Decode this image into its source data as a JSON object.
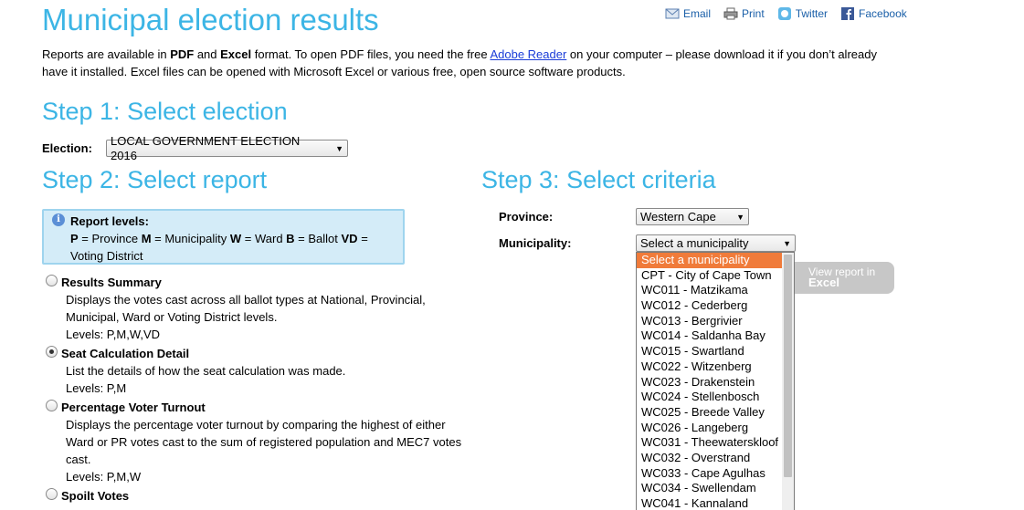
{
  "page": {
    "title": "Municipal election results",
    "intro": {
      "part1": "Reports are available in ",
      "pdf": "PDF",
      "part2": " and ",
      "excel": "Excel",
      "part3": " format. To open PDF files, you need the free ",
      "link": "Adobe Reader",
      "part4": " on your computer – please download it if you don’t already have it installed. Excel files can be opened with Microsoft Excel or various free, open source software products."
    }
  },
  "share": {
    "email": "Email",
    "print": "Print",
    "twitter": "Twitter",
    "facebook": "Facebook"
  },
  "step1": {
    "heading": "Step 1: Select election",
    "label": "Election:",
    "selected": "LOCAL GOVERNMENT ELECTION 2016"
  },
  "step2": {
    "heading": "Step 2: Select report",
    "info": {
      "title": "Report levels:",
      "p": "P",
      "p_txt": " = Province ",
      "m": "M",
      "m_txt": " = Municipality ",
      "w": "W",
      "w_txt": " = Ward ",
      "b": "B",
      "b_txt": " = Ballot ",
      "vd": "VD",
      "vd_txt": " = Voting District"
    },
    "reports": [
      {
        "name": "Results Summary",
        "desc": "Displays the votes cast across all ballot types at National, Provincial, Municipal, Ward or Voting District levels.",
        "levels": "Levels: P,M,W,VD",
        "checked": false
      },
      {
        "name": "Seat Calculation Detail",
        "desc": "List the details of how the seat calculation was made.",
        "levels": "Levels: P,M",
        "checked": true
      },
      {
        "name": "Percentage Voter Turnout",
        "desc": "Displays the percentage voter turnout by comparing the highest of either Ward or PR votes cast to the sum of registered population and MEC7 votes cast.",
        "levels": "Levels: P,M,W",
        "checked": false
      },
      {
        "name": "Spoilt Votes",
        "desc": "",
        "levels": "",
        "checked": false
      }
    ]
  },
  "step3": {
    "heading": "Step 3: Select criteria",
    "province_label": "Province:",
    "province_selected": "Western Cape",
    "municipality_label": "Municipality:",
    "municipality_selected": "Select a municipality",
    "municipality_options": [
      "Select a municipality",
      "CPT - City of Cape Town",
      "WC011 - Matzikama",
      "WC012 - Cederberg",
      "WC013 - Bergrivier",
      "WC014 - Saldanha Bay",
      "WC015 - Swartland",
      "WC022 - Witzenberg",
      "WC023 - Drakenstein",
      "WC024 - Stellenbosch",
      "WC025 - Breede Valley",
      "WC026 - Langeberg",
      "WC031 - Theewaterskloof",
      "WC032 - Overstrand",
      "WC033 - Cape Agulhas",
      "WC034 - Swellendam",
      "WC041 - Kannaland"
    ],
    "button_line1": "View report in",
    "button_line2": "Excel"
  },
  "colors": {
    "heading": "#3cb5e5",
    "highlight": "#f07b3a",
    "infobox_bg": "#d4ecf8",
    "link": "#1a5fa8"
  }
}
